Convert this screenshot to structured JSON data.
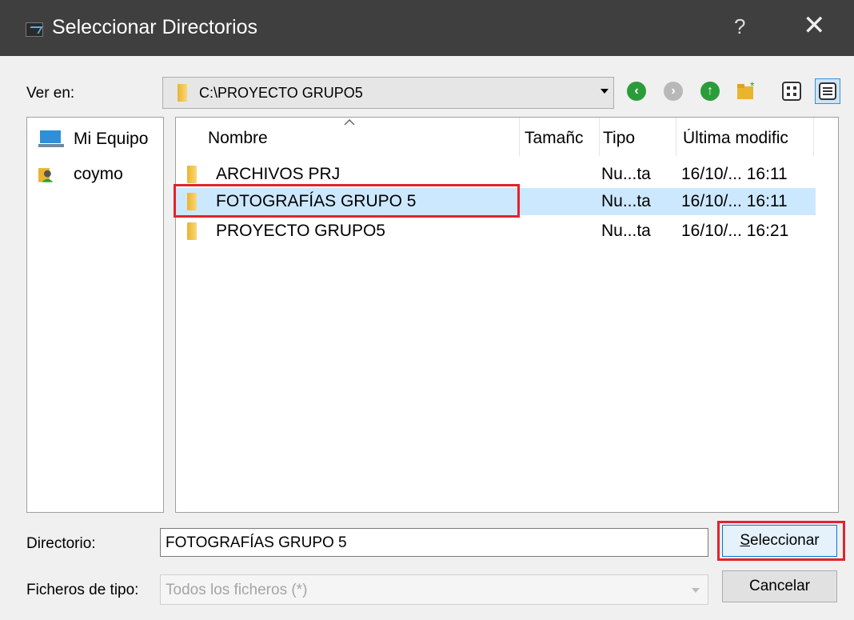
{
  "window": {
    "title": "Seleccionar Directorios",
    "help": "?",
    "close": "✕"
  },
  "lookin": {
    "label": "Ver en:",
    "path": "C:\\PROYECTO GRUPO5"
  },
  "toolbar": [
    "back-icon",
    "forward-icon",
    "up-icon",
    "new-folder-icon",
    "list-view-icon",
    "detail-view-icon"
  ],
  "sidebar": [
    {
      "label": "Mi Equipo",
      "icon": "computer-icon"
    },
    {
      "label": "coymo",
      "icon": "user-icon"
    }
  ],
  "columns": [
    "Nombre",
    "Tamañc",
    "Tipo",
    "Última modific"
  ],
  "rows": [
    {
      "name": "ARCHIVOS PRJ",
      "type": "Nu...ta",
      "date": "16/10/... 16:11"
    },
    {
      "name": "FOTOGRAFÍAS GRUPO 5",
      "type": "Nu...ta",
      "date": "16/10/... 16:11",
      "selected": true
    },
    {
      "name": "PROYECTO GRUPO5",
      "type": "Nu...ta",
      "date": "16/10/... 16:21"
    }
  ],
  "directory": {
    "label": "Directorio:",
    "value": "FOTOGRAFÍAS GRUPO 5"
  },
  "filetype": {
    "label": "Ficheros de tipo:",
    "value": "Todos los ficheros (*)"
  },
  "buttons": {
    "select_prefix": "S",
    "select_rest": "eleccionar",
    "cancel": "Cancelar"
  },
  "colors": {
    "accent": "#0078d7",
    "highlight": "#e1242c",
    "selection": "#cce8ff",
    "titlebar": "#3f3f3f"
  }
}
